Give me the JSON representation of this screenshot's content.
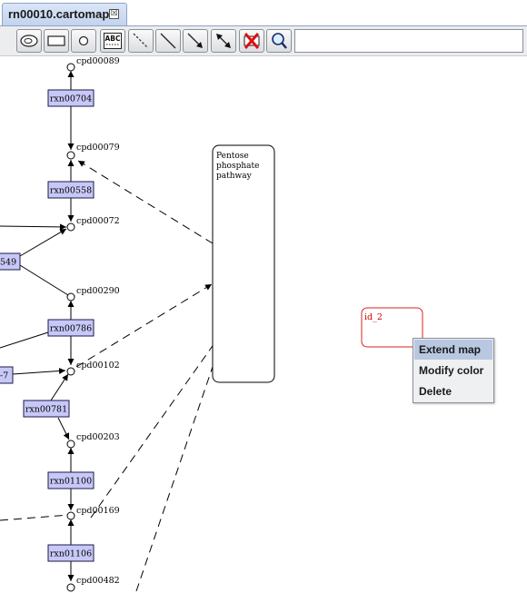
{
  "tab": {
    "title": "rn00010.cartomap",
    "close_glyph": "☒"
  },
  "toolbar": {
    "tools": [
      {
        "name": "compound-oval-tool",
        "icon": "oval-shape-icon"
      },
      {
        "name": "reaction-rect-tool",
        "icon": "rectangle-icon"
      },
      {
        "name": "circle-node-tool",
        "icon": "circle-icon"
      },
      {
        "name": "text-label-tool",
        "icon": "abc-text-icon",
        "label": "ABC"
      },
      {
        "name": "dashed-link-tool",
        "icon": "dashed-line-icon"
      },
      {
        "name": "solid-link-tool",
        "icon": "solid-line-icon"
      },
      {
        "name": "arrow-link-tool",
        "icon": "arrow-icon"
      },
      {
        "name": "double-arrow-link-tool",
        "icon": "double-arrow-icon"
      },
      {
        "name": "delete-tool",
        "icon": "red-x-icon"
      },
      {
        "name": "zoom-tool",
        "icon": "magnifier-icon"
      }
    ]
  },
  "map": {
    "compounds": [
      "cpd00089",
      "cpd00079",
      "cpd00072",
      "cpd00290",
      "cpd00102",
      "cpd00203",
      "cpd00169",
      "cpd00482"
    ],
    "reactions": [
      "rxn00704",
      "rxn00558",
      "rxn00786",
      "rxn00781",
      "rxn01100",
      "rxn01106"
    ],
    "partial_reactions": [
      "549",
      "-7"
    ],
    "pathway_box": {
      "lines": [
        "Pentose",
        "phosphate",
        "pathway"
      ]
    },
    "selected_box": {
      "label": "id_2"
    },
    "colors": {
      "reaction_fill": "#c8c8f8",
      "reaction_border": "#1a1a4a",
      "selected_border": "#dd2222",
      "menu_highlight": "#b8c8e0"
    }
  },
  "context_menu": {
    "items": [
      {
        "label": "Extend map",
        "highlighted": true
      },
      {
        "label": "Modify color",
        "highlighted": false
      },
      {
        "label": "Delete",
        "highlighted": false
      }
    ]
  }
}
